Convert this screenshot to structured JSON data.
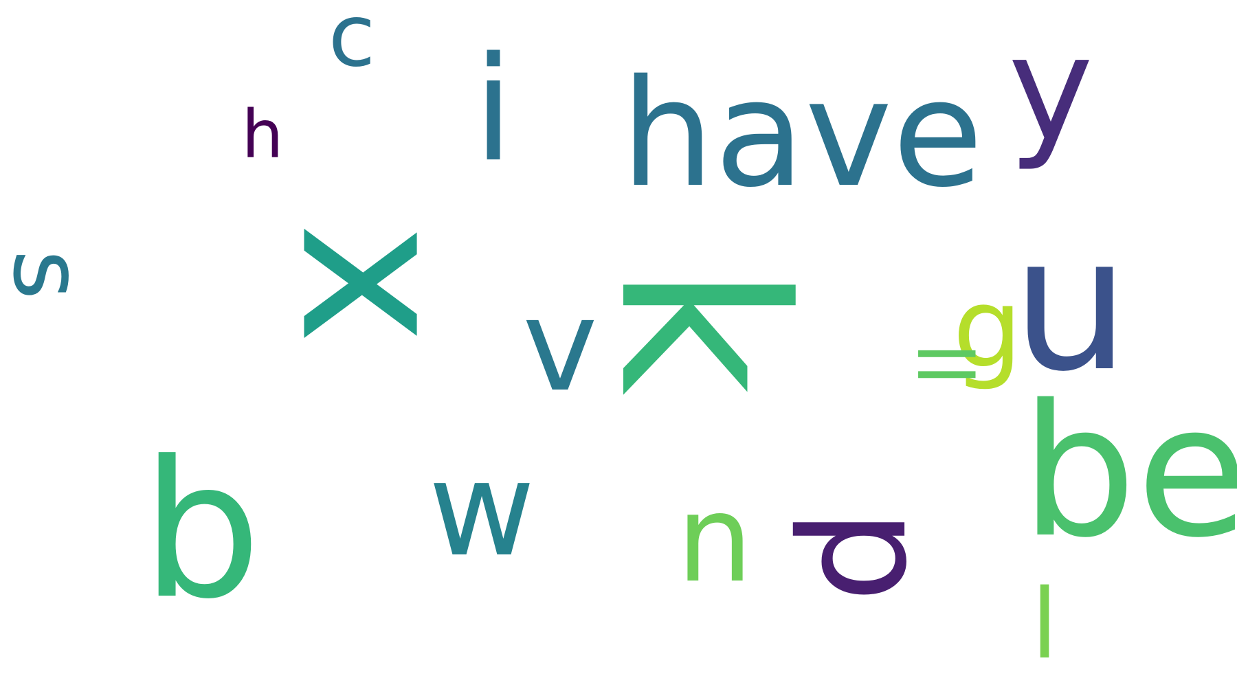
{
  "word_cloud": {
    "words": [
      {
        "text": "x",
        "color": "#1f9e89"
      },
      {
        "text": "k",
        "color": "#35b779"
      },
      {
        "text": "have",
        "color": "#2c728e"
      },
      {
        "text": "be",
        "color": "#4ac16d"
      },
      {
        "text": "b",
        "color": "#35b779"
      },
      {
        "text": "u",
        "color": "#3b528b"
      },
      {
        "text": "p",
        "color": "#481f70"
      },
      {
        "text": "i",
        "color": "#2c728e"
      },
      {
        "text": "w",
        "color": "#26828e"
      },
      {
        "text": "y",
        "color": "#472d7b"
      },
      {
        "text": "v",
        "color": "#2a788e"
      },
      {
        "text": "n",
        "color": "#6ece58"
      },
      {
        "text": "s",
        "color": "#2a788e"
      },
      {
        "text": "c",
        "color": "#2c728e"
      },
      {
        "text": "g",
        "color": "#b5de2b"
      },
      {
        "text": "ll",
        "color": "#5ec962"
      },
      {
        "text": "l",
        "color": "#7ad151"
      },
      {
        "text": "h",
        "color": "#440154"
      }
    ]
  }
}
